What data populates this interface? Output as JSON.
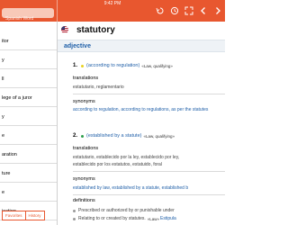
{
  "status": {
    "time": "9:42 PM"
  },
  "search": {
    "placeholder": "Spanish Word"
  },
  "nav_icons": [
    "history-back-icon",
    "clock-icon",
    "expand-icon",
    "chevron-left-icon",
    "chevron-right-icon"
  ],
  "sidebar": {
    "items": [
      {
        "label": "itor"
      },
      {
        "label": "y"
      },
      {
        "label": "ll"
      },
      {
        "label": "lege of a juror"
      },
      {
        "label": "y"
      },
      {
        "label": "e"
      },
      {
        "label": "aration"
      },
      {
        "label": "ture"
      },
      {
        "label": "e"
      },
      {
        "label": "ication"
      }
    ],
    "tabs": [
      {
        "label": "Favorites"
      },
      {
        "label": "History"
      }
    ]
  },
  "entry": {
    "headword": "statutory",
    "part_of_speech": "adjective",
    "senses": [
      {
        "number": "1.",
        "dot_color": "#e8d21f",
        "gloss": "(according to regulation)",
        "labels": "«Law, qualifying»",
        "translations_title": "translations",
        "translations": "estatutario, reglamentario",
        "synonyms_title": "synonyms",
        "synonyms": "according to regulation, according to regulations, as per the statutes"
      },
      {
        "number": "2.",
        "dot_color": "#2d9f4c",
        "gloss": "(established by a statute)",
        "labels": "«Law, qualifying»",
        "translations_title": "translations",
        "translations_line1": "estatutario, establecido por la ley, establecido por ley,",
        "translations_line2": "establecido por los estatutos, estatuido, foral",
        "synonyms_title": "synonyms",
        "synonyms": "established by law, established by a statute, established b",
        "definitions_title": "definitions",
        "definitions": [
          {
            "text": "Prescribed or authorized by or punishable under"
          },
          {
            "text": "Relating to or created by statutes.",
            "label": "«Law»",
            "link": "Estipula"
          }
        ]
      }
    ]
  },
  "colors": {
    "accent": "#e8572f",
    "link": "#1f5fa8",
    "pos_bar": "#eef2f6"
  }
}
